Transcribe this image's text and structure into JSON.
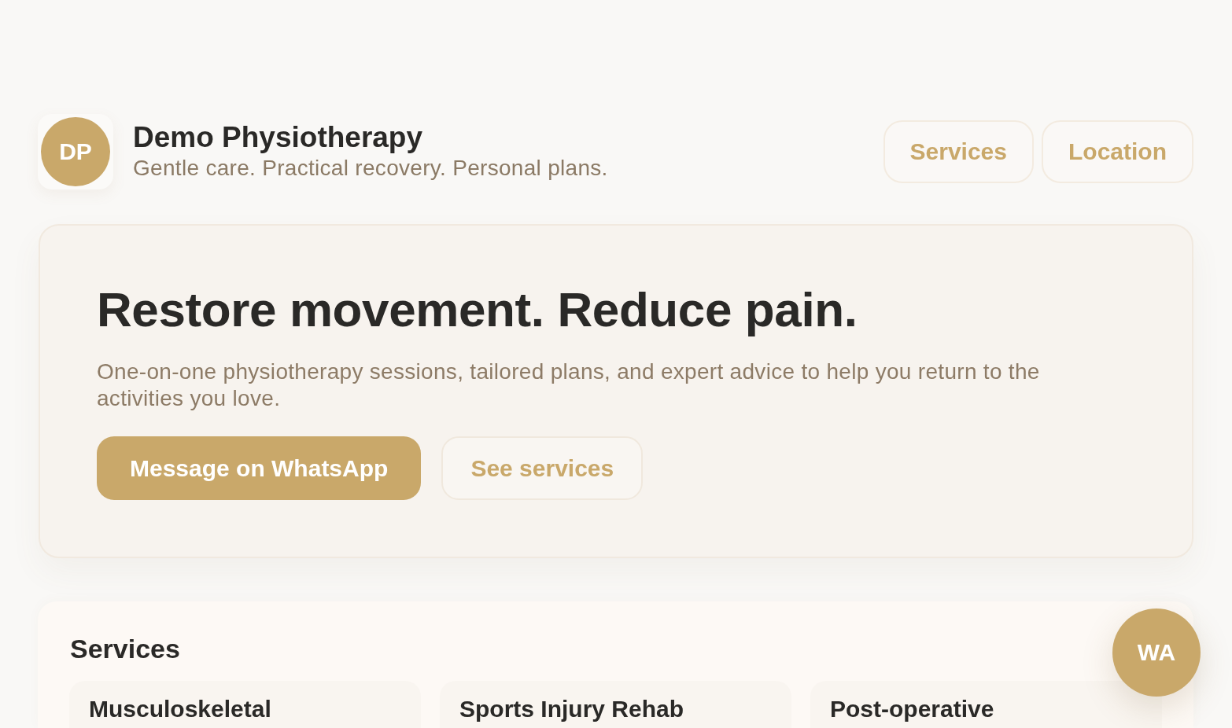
{
  "header": {
    "logo": {
      "initials": "DP"
    },
    "title": "Demo Physiotherapy",
    "tagline": "Gentle care. Practical recovery. Personal plans."
  },
  "nav": [
    {
      "label": "Services"
    },
    {
      "label": "Location"
    }
  ],
  "hero": {
    "heading": "Restore movement. Reduce pain.",
    "text": "One-on-one physiotherapy sessions, tailored plans, and expert advice to help you return to the activities you love.",
    "buttons": [
      {
        "label": "Message on WhatsApp",
        "kind": "primary"
      },
      {
        "label": "See services",
        "kind": "secondary"
      }
    ]
  },
  "services": {
    "heading": "Services",
    "cards": [
      {
        "title": "Musculoskeletal"
      },
      {
        "title": "Sports Injury Rehab"
      },
      {
        "title": "Post-operative"
      }
    ]
  },
  "floating_button": {
    "label": "WA"
  }
}
